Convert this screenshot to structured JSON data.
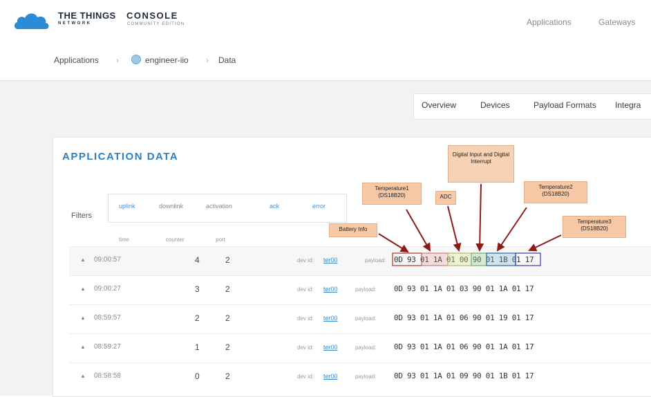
{
  "header": {
    "brand_line1": "THE THINGS",
    "brand_line2": "NETWORK",
    "product": "CONSOLE",
    "edition": "COMMUNITY EDITION",
    "nav": [
      "Applications",
      "Gateways"
    ]
  },
  "breadcrumb": {
    "items": [
      "Applications",
      "engineer-iio",
      "Data"
    ],
    "separator": "›"
  },
  "app_tabs": [
    "Overview",
    "Devices",
    "Payload Formats",
    "Integra"
  ],
  "section_title": "APPLICATION DATA",
  "filters": {
    "label": "Filters",
    "items": [
      "uplink",
      "downlink",
      "activation",
      "ack",
      "error"
    ]
  },
  "columns": [
    "time",
    "counter",
    "port"
  ],
  "rows": [
    {
      "time": "09:00:57",
      "counter": "4",
      "port": "2",
      "dev_label": "dev id:",
      "dev_id": "ter00",
      "payload_label": "payload:",
      "payload": "0D 93 01 1A 01 00 90 01 1B 01 17"
    },
    {
      "time": "09:00:27",
      "counter": "3",
      "port": "2",
      "dev_label": "dev id:",
      "dev_id": "ter00",
      "payload_label": "payload:",
      "payload": "0D 93 01 1A 01 03 90 01 1A 01 17"
    },
    {
      "time": "08:59:57",
      "counter": "2",
      "port": "2",
      "dev_label": "dev id:",
      "dev_id": "ter00",
      "payload_label": "payload:",
      "payload": "0D 93 01 1A 01 06 90 01 19 01 17"
    },
    {
      "time": "08:59:27",
      "counter": "1",
      "port": "2",
      "dev_label": "dev id:",
      "dev_id": "ter00",
      "payload_label": "payload:",
      "payload": "0D 93 01 1A 01 06 90 01 1A 01 17"
    },
    {
      "time": "08:58:58",
      "counter": "0",
      "port": "2",
      "dev_label": "dev id:",
      "dev_id": "ter00",
      "payload_label": "payload:",
      "payload": "0D 93 01 1A 01 09 90 01 1B 01 17"
    }
  ],
  "annotations": {
    "battery": "Battery Info",
    "temp1": "Temperature1 (DS18B20)",
    "adc": "ADC",
    "digital": "Digital Input and Digital Interrupt",
    "temp2": "Temperature2 (DS18B20)",
    "temp3": "Temperature3 (DS18B20)"
  },
  "colors": {
    "brand_blue": "#2e7fc0",
    "link_blue": "#3a8ad0",
    "annotation_fill": "#f7c9a6",
    "arrow": "#8b1a1a"
  },
  "icons": [
    "cloud-logo-icon",
    "globe-icon",
    "caret-up-icon"
  ]
}
